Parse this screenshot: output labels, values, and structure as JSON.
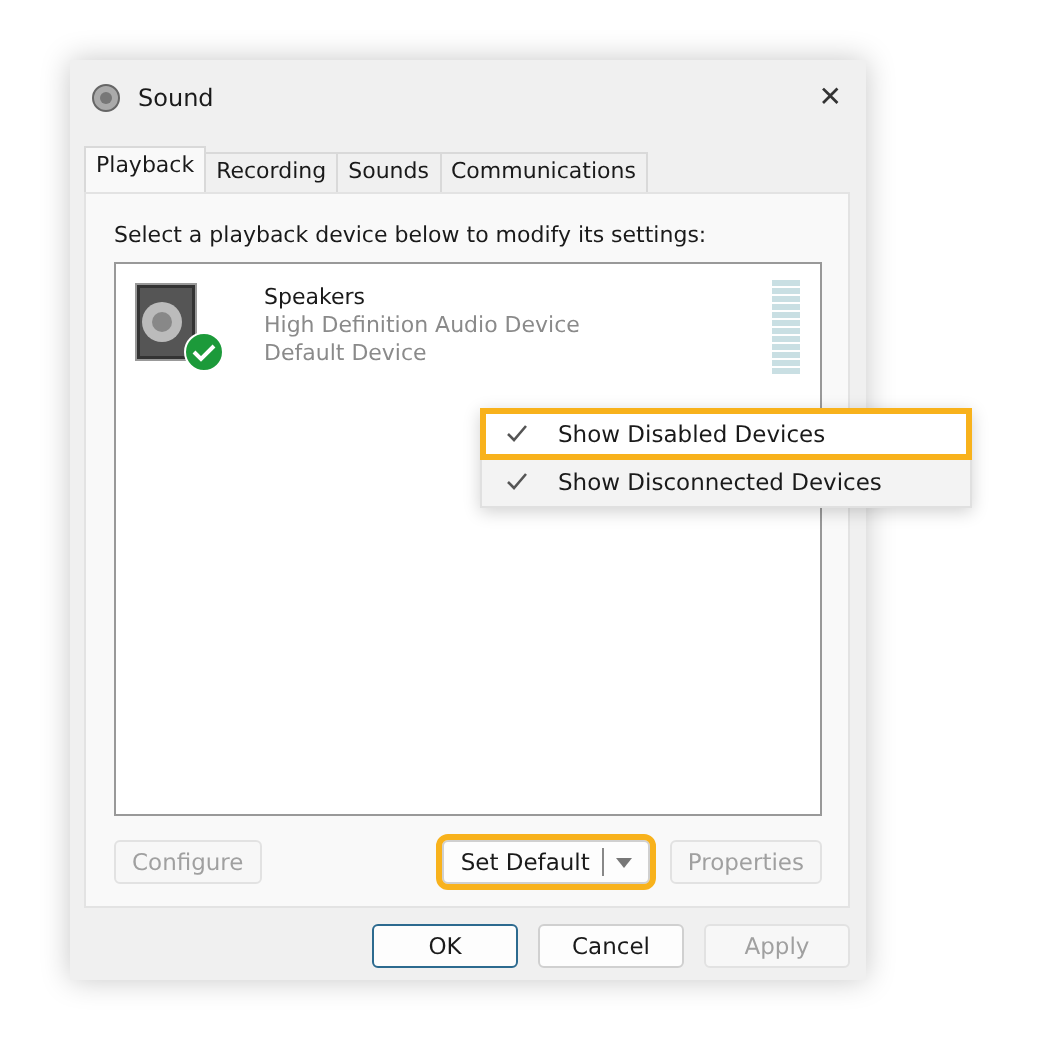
{
  "window": {
    "title": "Sound",
    "close": "✕"
  },
  "tabs": [
    {
      "label": "Playback",
      "selected": true
    },
    {
      "label": "Recording",
      "selected": false
    },
    {
      "label": "Sounds",
      "selected": false
    },
    {
      "label": "Communications",
      "selected": false
    }
  ],
  "instruction": "Select a playback device below to modify its settings:",
  "devices": [
    {
      "name": "Speakers",
      "description": "High Definition Audio Device",
      "status": "Default Device",
      "is_default": true
    }
  ],
  "context_menu": [
    {
      "label": "Show Disabled Devices",
      "checked": true,
      "highlighted": true
    },
    {
      "label": "Show Disconnected Devices",
      "checked": true,
      "highlighted": false
    }
  ],
  "device_buttons": [
    {
      "label": "Configure",
      "disabled": true,
      "split": false,
      "highlighted": false
    },
    {
      "label": "Set Default",
      "disabled": false,
      "split": true,
      "highlighted": true
    },
    {
      "label": "Properties",
      "disabled": true,
      "split": false,
      "highlighted": false
    }
  ],
  "dialog_buttons": [
    {
      "label": "OK",
      "disabled": false,
      "default": true
    },
    {
      "label": "Cancel",
      "disabled": false,
      "default": false
    },
    {
      "label": "Apply",
      "disabled": true,
      "default": false
    }
  ]
}
